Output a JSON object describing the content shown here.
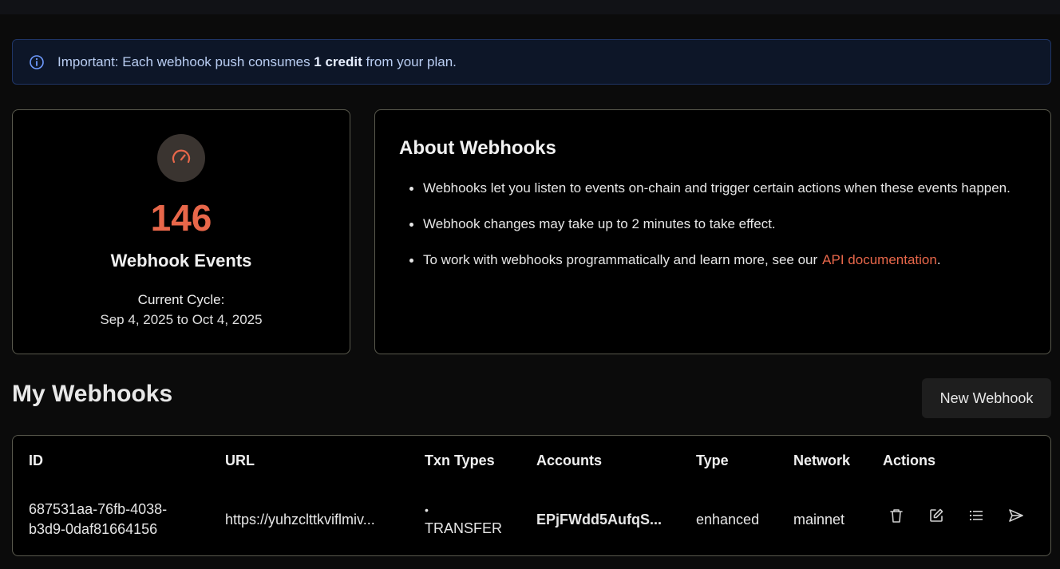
{
  "notice": {
    "prefix": "Important: Each webhook push consumes ",
    "strong": "1 credit",
    "suffix": " from your plan.",
    "icon": "info-icon"
  },
  "stats": {
    "icon": "gauge-icon",
    "count": "146",
    "label": "Webhook Events",
    "cycle_label": "Current Cycle:",
    "cycle_range": "Sep 4, 2025 to Oct 4, 2025",
    "accent_color": "#e8674a"
  },
  "about": {
    "title": "About Webhooks",
    "bullets": [
      "Webhooks let you listen to events on-chain and trigger certain actions when these events happen.",
      "Webhook changes may take up to 2 minutes to take effect.",
      "To work with webhooks programmatically and learn more, see our"
    ],
    "link_text": "API documentation",
    "link_suffix": "."
  },
  "webhooks": {
    "title": "My Webhooks",
    "new_button": "New Webhook",
    "columns": [
      "ID",
      "URL",
      "Txn Types",
      "Accounts",
      "Type",
      "Network",
      "Actions"
    ],
    "rows": [
      {
        "id_line1": "687531aa-76fb-4038-",
        "id_line2": "b3d9-0daf81664156",
        "url": "https://yuhzclttkviflmiv...",
        "txn_bullet": "•",
        "txn_type": "TRANSFER",
        "accounts": "EPjFWdd5AufqS...",
        "type": "enhanced",
        "network": "mainnet",
        "actions": [
          "trash-icon",
          "edit-icon",
          "list-icon",
          "send-icon"
        ]
      }
    ]
  }
}
